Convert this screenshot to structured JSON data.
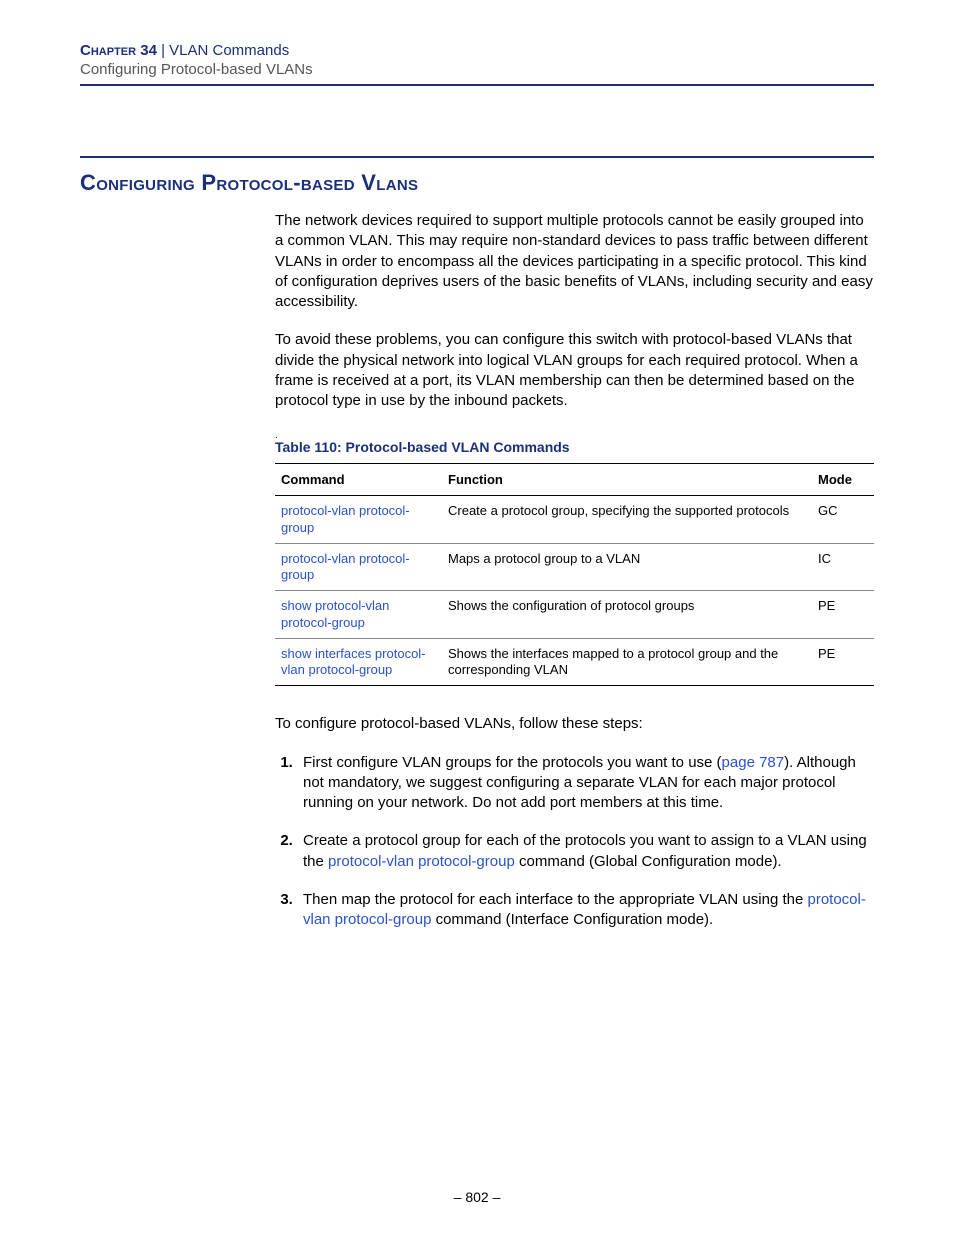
{
  "header": {
    "chapter_label": "Chapter 34",
    "separator": "  |  ",
    "chapter_title": "VLAN Commands",
    "section": "Configuring Protocol-based VLANs"
  },
  "section_title": "Configuring Protocol-based Vlans",
  "para1": "The network devices required to support multiple protocols cannot be easily grouped into a common VLAN. This may require non-standard devices to pass traffic between different VLANs in order to encompass all the devices participating in a specific protocol. This kind of configuration deprives users of the basic benefits of VLANs, including security and easy accessibility.",
  "para2": "To avoid these problems, you can configure this switch with protocol-based VLANs that divide the physical network into logical VLAN groups for each required protocol. When a frame is received at a port, its VLAN membership can then be determined based on the protocol type in use by the inbound packets.",
  "table": {
    "caption": "Table 110: Protocol-based VLAN Commands",
    "headers": {
      "command": "Command",
      "function": "Function",
      "mode": "Mode"
    },
    "rows": [
      {
        "command": "protocol-vlan protocol-group",
        "function": "Create a protocol group, specifying the supported protocols",
        "mode": "GC"
      },
      {
        "command": "protocol-vlan protocol-group",
        "function": "Maps a protocol group to a VLAN",
        "mode": "IC"
      },
      {
        "command": "show protocol-vlan protocol-group",
        "function": "Shows the configuration of protocol groups",
        "mode": "PE"
      },
      {
        "command": "show interfaces protocol-vlan protocol-group",
        "function": "Shows the interfaces mapped to a protocol group and the corresponding VLAN",
        "mode": "PE"
      }
    ]
  },
  "steps_intro": "To configure protocol-based VLANs, follow these steps:",
  "steps": {
    "s1a": "First configure VLAN groups for the protocols you want to use (",
    "s1_link": "page 787",
    "s1b": "). Although not mandatory, we suggest configuring a separate VLAN for each major protocol running on your network. Do not add port members at this time.",
    "s2a": "Create a protocol group for each of the protocols you want to assign to a VLAN using the ",
    "s2_link": "protocol-vlan protocol-group",
    "s2b": " command (Global Configuration mode).",
    "s3a": "Then map the protocol for each interface to the appropriate VLAN using the ",
    "s3_link": "protocol-vlan protocol-group",
    "s3b": " command (Interface Configuration mode)."
  },
  "page_number": "– 802 –"
}
